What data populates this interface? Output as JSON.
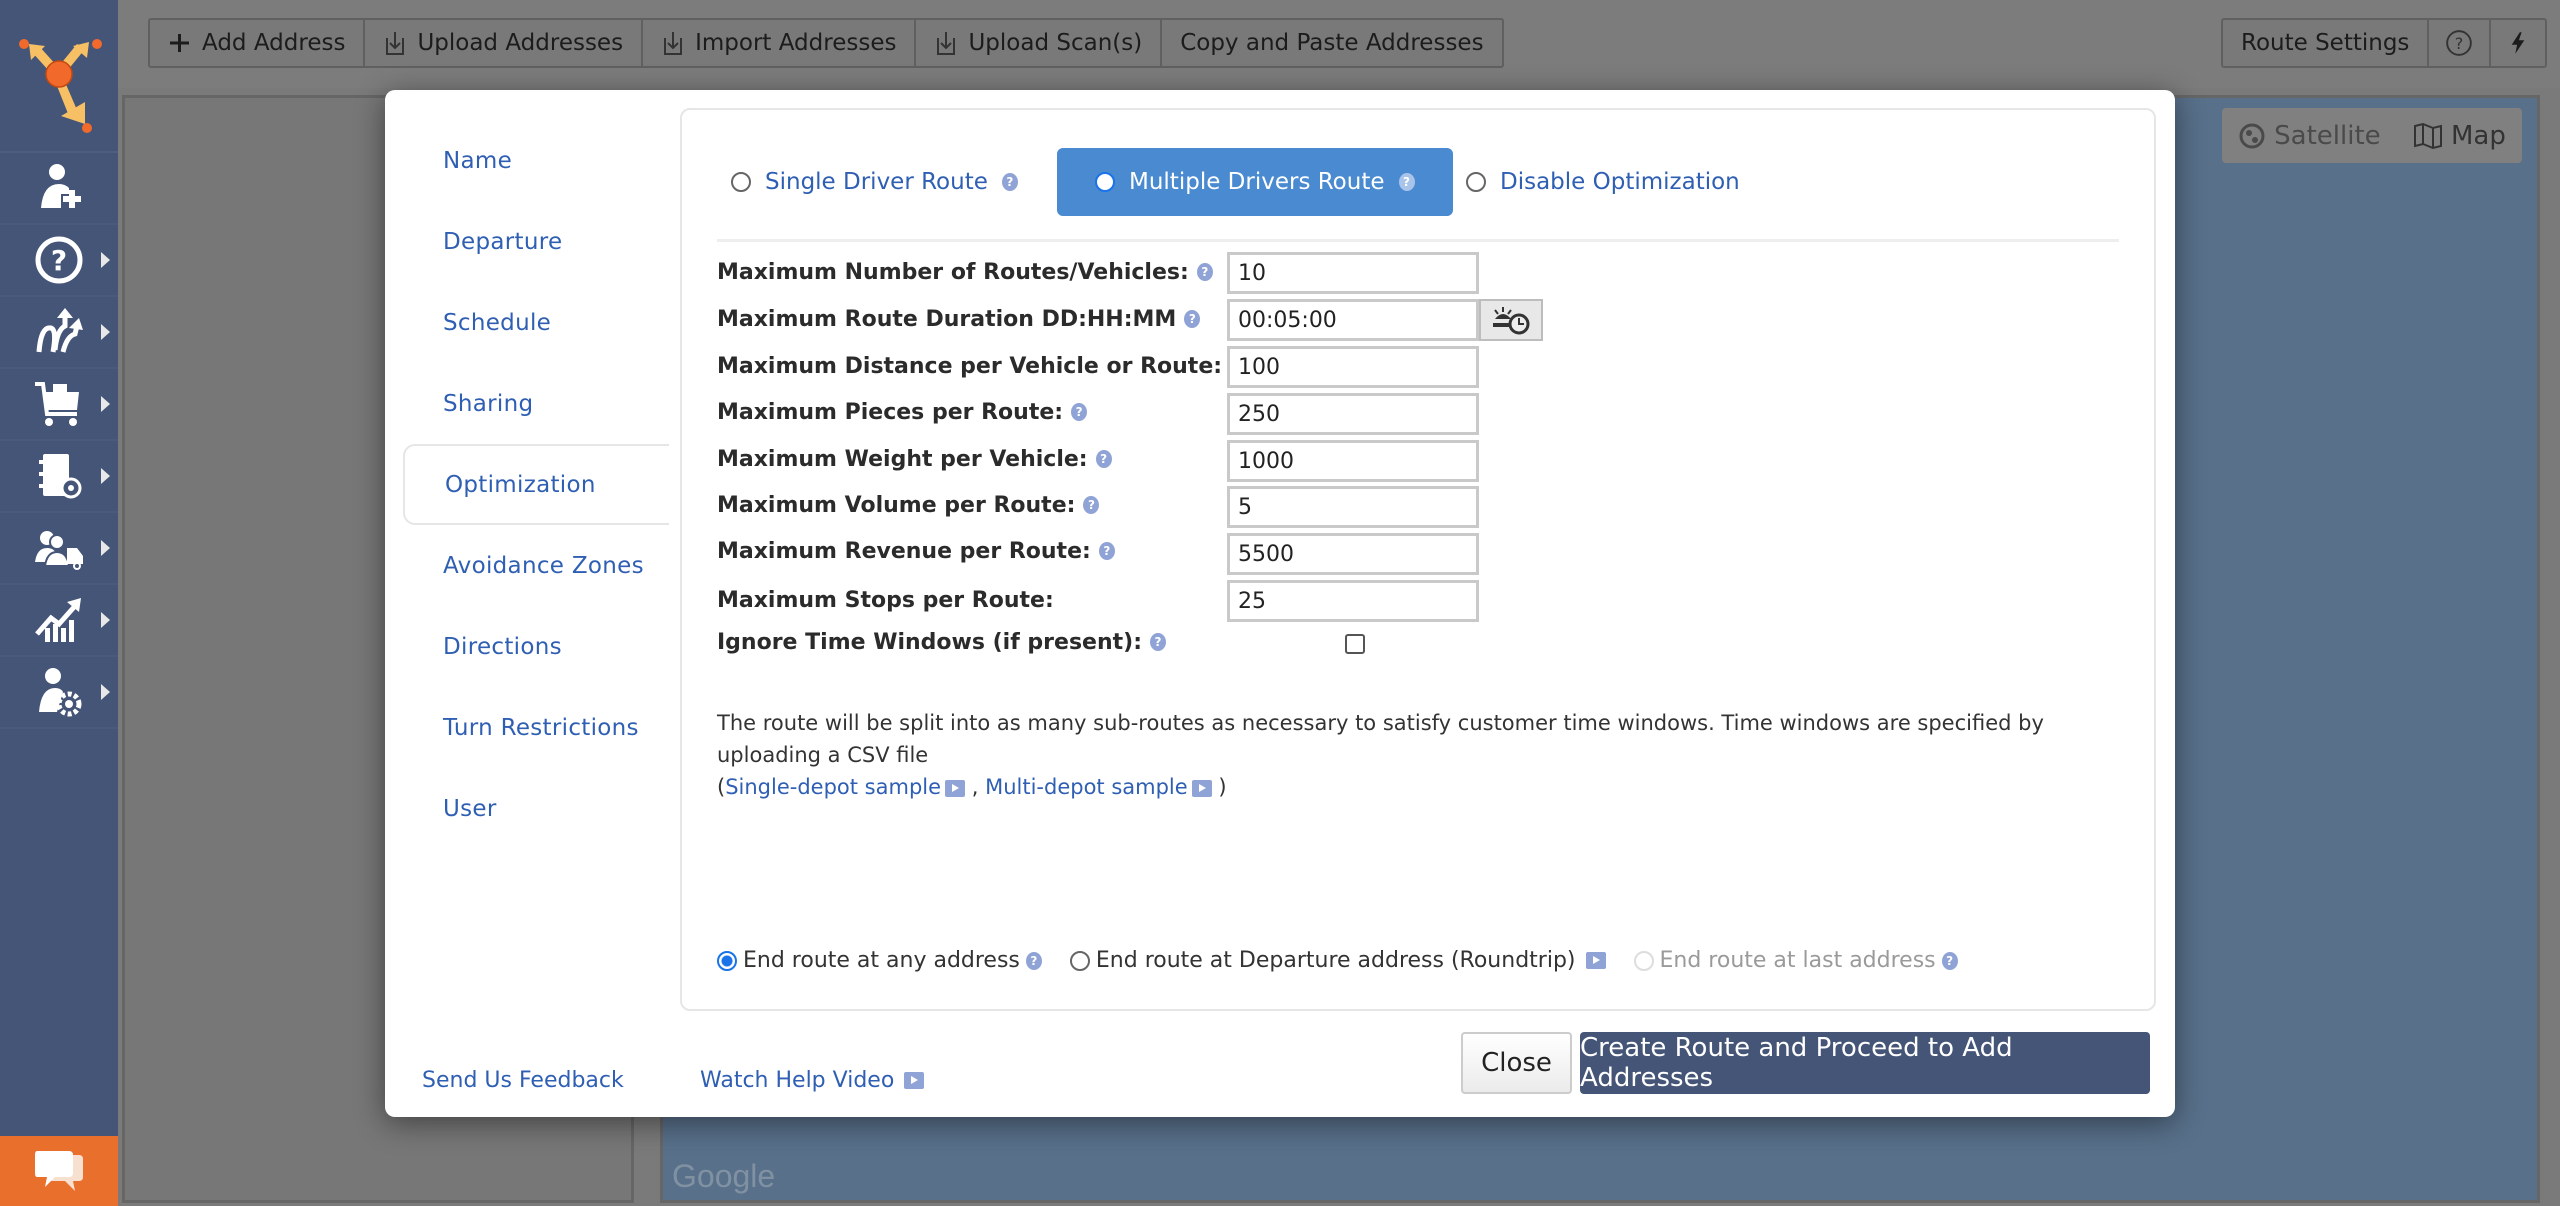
{
  "toolbar": {
    "left_buttons": [
      {
        "label": "Add Address",
        "icon": "plus-icon"
      },
      {
        "label": "Upload Addresses",
        "icon": "upload-icon"
      },
      {
        "label": "Import Addresses",
        "icon": "import-icon"
      },
      {
        "label": "Upload Scan(s)",
        "icon": "upload-scan-icon"
      },
      {
        "label": "Copy and Paste Addresses",
        "icon": ""
      }
    ],
    "route_settings_label": "Route Settings",
    "help_icon": "question-circle-icon",
    "flash_icon": "lightning-icon"
  },
  "leftnav": {
    "logo": "route4me-logo",
    "items": [
      {
        "name": "add-user",
        "icon": "user-plus-icon",
        "has_submenu": false
      },
      {
        "name": "help",
        "icon": "question-circle-icon",
        "has_submenu": true
      },
      {
        "name": "routes",
        "icon": "routes-icon",
        "has_submenu": true
      },
      {
        "name": "orders",
        "icon": "cart-icon",
        "has_submenu": true
      },
      {
        "name": "address-book",
        "icon": "address-book-icon",
        "has_submenu": true
      },
      {
        "name": "team-vehicles",
        "icon": "team-truck-icon",
        "has_submenu": true
      },
      {
        "name": "analytics",
        "icon": "chart-up-icon",
        "has_submenu": true
      },
      {
        "name": "settings",
        "icon": "user-gear-icon",
        "has_submenu": true
      }
    ],
    "chat_icon": "chat-bubbles-icon"
  },
  "map": {
    "satellite_label": "Satellite",
    "map_label": "Map",
    "watermark": "Google"
  },
  "modal": {
    "tabs": [
      {
        "label": "Name",
        "active": false
      },
      {
        "label": "Departure",
        "active": false
      },
      {
        "label": "Schedule",
        "active": false
      },
      {
        "label": "Sharing",
        "active": false
      },
      {
        "label": "Optimization",
        "active": true
      },
      {
        "label": "Avoidance Zones",
        "active": false
      },
      {
        "label": "Directions",
        "active": false
      },
      {
        "label": "Turn Restrictions",
        "active": false
      },
      {
        "label": "User",
        "active": false
      }
    ],
    "route_types": [
      {
        "label": "Single Driver Route",
        "selected": false,
        "help": true
      },
      {
        "label": "Multiple Drivers Route",
        "selected": true,
        "help": true
      },
      {
        "label": "Disable Optimization",
        "selected": false,
        "help": false
      }
    ],
    "fields": [
      {
        "label": "Maximum Number of Routes/Vehicles:",
        "value": "10",
        "help": true
      },
      {
        "label": "Maximum Route Duration DD:HH:MM",
        "value": "00:05:00",
        "help": true
      },
      {
        "label": "Maximum Distance per Vehicle or Route:",
        "value": "100",
        "help": true
      },
      {
        "label": "Maximum Pieces per Route:",
        "value": "250",
        "help": true
      },
      {
        "label": "Maximum Weight per Vehicle:",
        "value": "1000",
        "help": true
      },
      {
        "label": "Maximum Volume per Route:",
        "value": "5",
        "help": true
      },
      {
        "label": "Maximum Revenue per Route:",
        "value": "5500",
        "help": true
      },
      {
        "label": "Maximum Stops per Route:",
        "value": "25",
        "help": false
      }
    ],
    "ignore_time_windows": {
      "label": "Ignore Time Windows (if present):",
      "checked": false
    },
    "info_text": "The route will be split into as many sub-routes as necessary to satisfy customer time windows. Time windows are specified by uploading a CSV file",
    "sample_open": "(",
    "single_depot_link": "Single-depot sample",
    "sample_sep": " ,",
    "multi_depot_link": "Multi-depot sample",
    "sample_close": ")",
    "end_options": [
      {
        "label": "End route at any address",
        "selected": true,
        "disabled": false,
        "suffix": "help"
      },
      {
        "label": "End route at Departure address (Roundtrip)",
        "selected": false,
        "disabled": false,
        "suffix": "video"
      },
      {
        "label": "End route at last address",
        "selected": false,
        "disabled": true,
        "suffix": "help"
      }
    ],
    "feedback_link": "Send Us Feedback",
    "help_video_link": "Watch Help Video",
    "close_label": "Close",
    "create_label": "Create Route and Proceed to Add Addresses"
  },
  "colors": {
    "nav_bg": "#455577",
    "accent_blue": "#4a8ad0",
    "link_blue": "#2f5fb3",
    "chat_orange": "#e8702c",
    "primary_button": "#455577"
  }
}
